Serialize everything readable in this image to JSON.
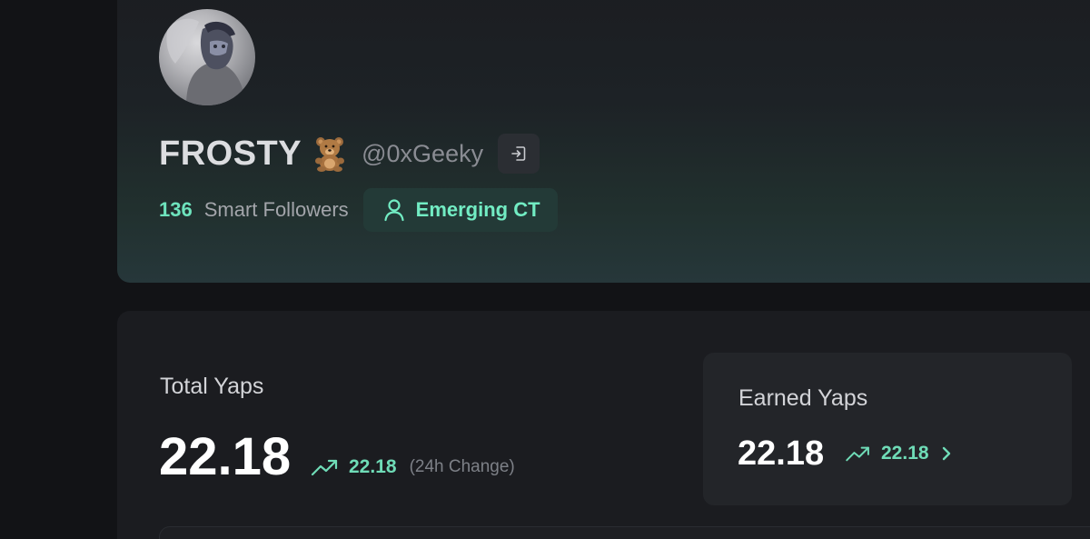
{
  "profile": {
    "display_name": "FROSTY",
    "name_emoji": "teddy-bear-emoji",
    "handle": "@0xGeeky",
    "smart_followers_count": "136",
    "smart_followers_label": "Smart Followers",
    "badge_label": "Emerging CT",
    "badge_icon": "user-icon",
    "logout_icon": "sign-in-icon"
  },
  "yaps": {
    "total_title": "Total Yaps",
    "total_value": "22.18",
    "total_change": "22.18",
    "total_change_note": "(24h Change)",
    "earned_title": "Earned Yaps",
    "earned_value": "22.18",
    "earned_change": "22.18"
  },
  "colors": {
    "accent": "#6ee3bd",
    "background": "#121316",
    "card": "#1b1c20",
    "badge_bg": "#233a37"
  }
}
